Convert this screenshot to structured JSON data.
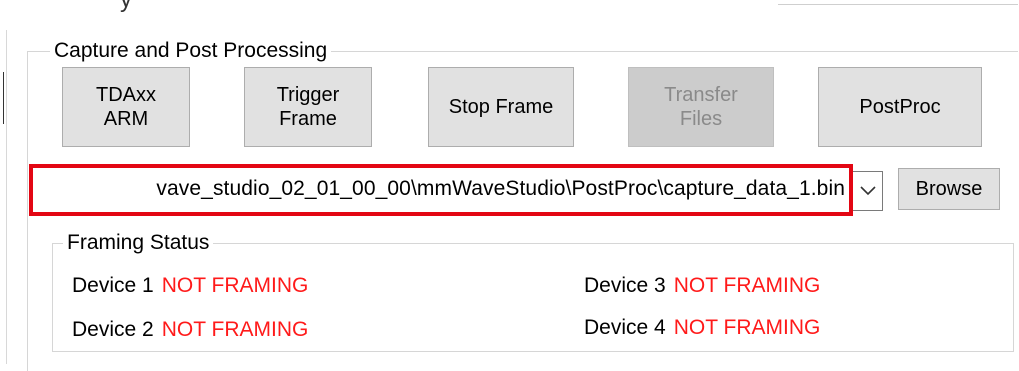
{
  "top_fragment": "y",
  "capture_group": {
    "legend": "Capture and Post Processing",
    "buttons": {
      "tdaxx_arm": "TDAxx\nARM",
      "trigger_frame": "Trigger\nFrame",
      "stop_frame": "Stop Frame",
      "transfer_files": "Transfer\nFiles",
      "postproc": "PostProc"
    },
    "file_path": "vave_studio_02_01_00_00\\mmWaveStudio\\PostProc\\capture_data_1.bin",
    "browse_label": "Browse"
  },
  "framing_status": {
    "legend": "Framing Status",
    "devices": [
      {
        "label": "Device 1",
        "status": "NOT FRAMING"
      },
      {
        "label": "Device 2",
        "status": "NOT FRAMING"
      },
      {
        "label": "Device 3",
        "status": "NOT FRAMING"
      },
      {
        "label": "Device 4",
        "status": "NOT FRAMING"
      }
    ]
  },
  "colors": {
    "status_text": "#ff1a1a",
    "highlight_border": "#e30613",
    "button_bg": "#e1e1e1"
  },
  "icons": {
    "dropdown": "chevron-down-icon"
  }
}
